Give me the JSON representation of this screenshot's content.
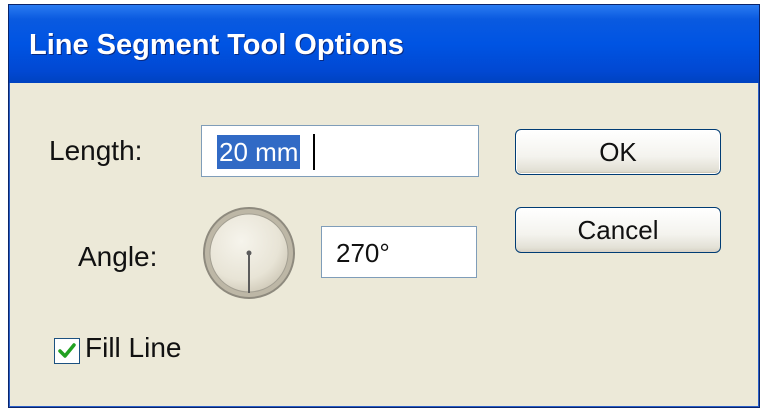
{
  "dialog": {
    "title": "Line Segment Tool Options"
  },
  "length": {
    "label": "Length:",
    "value": "20 mm"
  },
  "angle": {
    "label": "Angle:",
    "value": "270°",
    "dial_degrees": 270
  },
  "fill_line": {
    "label": "Fill Line",
    "checked": true
  },
  "buttons": {
    "ok": "OK",
    "cancel": "Cancel"
  },
  "colors": {
    "titlebar": "#0054e3",
    "dialog_bg": "#ece9d8",
    "selection": "#316ac5",
    "check": "#21a121"
  },
  "icons": {
    "check": "checkmark-icon",
    "dial": "angle-dial-icon"
  }
}
